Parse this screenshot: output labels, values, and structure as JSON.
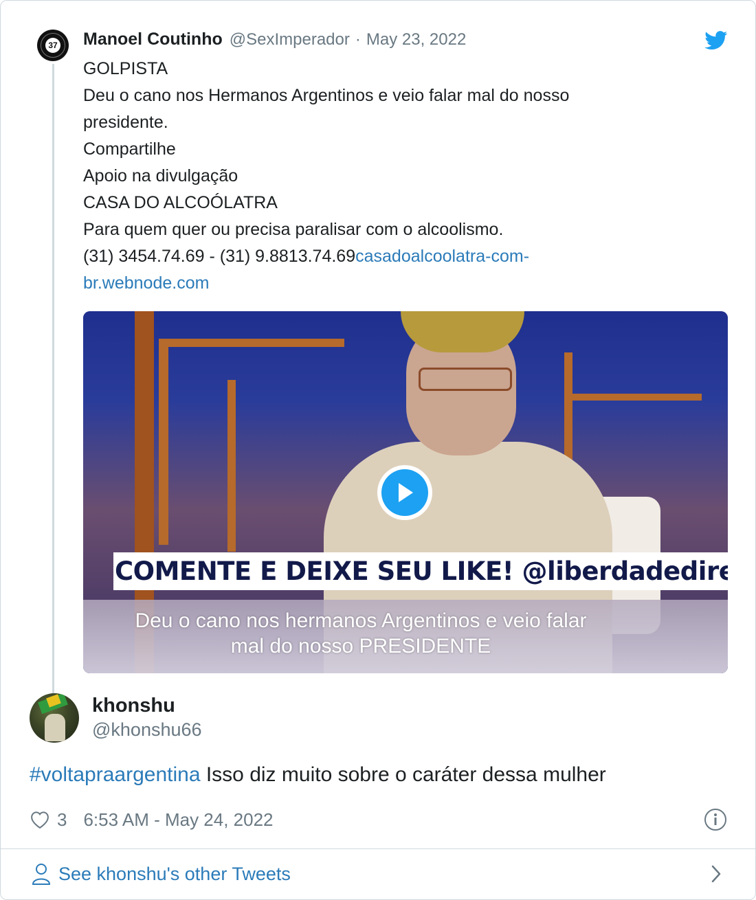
{
  "parent_tweet": {
    "avatar_badge": "37",
    "author_name": "Manoel Coutinho",
    "author_handle": "@SexImperador",
    "separator": "·",
    "date": "May 23, 2022",
    "lines": [
      "GOLPISTA",
      "Deu o cano nos Hermanos Argentinos e veio falar mal do nosso presidente.",
      "Compartilhe",
      "Apoio na divulgação",
      "CASA DO ALCOÓLATRA",
      "Para quem quer ou precisa paralisar com o alcoolismo."
    ],
    "phones": "(31) 3454.74.69 - (31) 9.8813.74.69",
    "link_text": "casadoalcoolatra-com-br.webnode.com",
    "video": {
      "banner_text": "COMENTE E DEIXE SEU LIKE! @liberdadedireita",
      "caption": "Deu o  cano nos hermanos Argentinos e veio falar mal do nosso PRESIDENTE"
    }
  },
  "reply_tweet": {
    "author_name": "khonshu",
    "author_handle": "@khonshu66",
    "hashtag": "#voltapraargentina",
    "text": " Isso diz muito sobre o caráter dessa mulher",
    "like_count": "3",
    "timestamp": "6:53 AM - May 24, 2022"
  },
  "footer": {
    "link_label": "See khonshu's other Tweets"
  },
  "colors": {
    "link": "#2b7bb9",
    "twitter_blue": "#1da1f2",
    "secondary_text": "#697882",
    "border": "#cfd9de"
  },
  "icons": [
    "twitter-bird-icon",
    "play-icon",
    "heart-icon",
    "info-icon",
    "person-icon",
    "chevron-right-icon"
  ]
}
